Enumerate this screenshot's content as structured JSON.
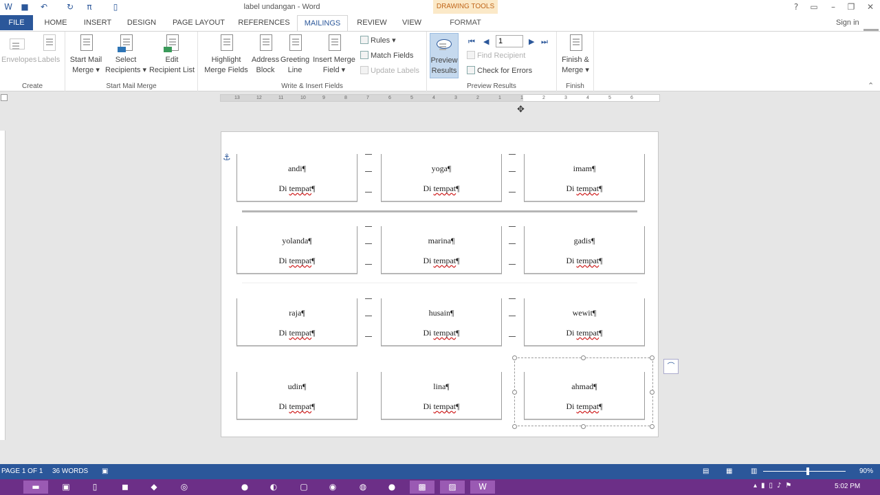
{
  "window": {
    "title": "label undangan - Word",
    "contextual_tab_header": "DRAWING TOOLS",
    "help": "?",
    "sign_in": "Sign in"
  },
  "quick_access": {
    "save_icon": "save-icon",
    "undo_icon": "undo-icon",
    "redo_icon": "redo-icon",
    "equation_icon": "equation-icon",
    "new_doc_icon": "new-document-icon"
  },
  "tabs": {
    "file": "FILE",
    "home": "HOME",
    "insert": "INSERT",
    "design": "DESIGN",
    "page_layout": "PAGE LAYOUT",
    "references": "REFERENCES",
    "mailings": "MAILINGS",
    "review": "REVIEW",
    "view": "VIEW",
    "format": "FORMAT",
    "active": "MAILINGS"
  },
  "ribbon": {
    "create": {
      "label": "Create",
      "envelopes": "Envelopes",
      "labels": "Labels"
    },
    "start_mail_merge": {
      "label": "Start Mail Merge",
      "start_line1": "Start Mail",
      "start_line2": "Merge ▾",
      "select_line1": "Select",
      "select_line2": "Recipients ▾",
      "edit_line1": "Edit",
      "edit_line2": "Recipient List"
    },
    "write_insert": {
      "label": "Write & Insert Fields",
      "highlight_line1": "Highlight",
      "highlight_line2": "Merge Fields",
      "address_line1": "Address",
      "address_line2": "Block",
      "greeting_line1": "Greeting",
      "greeting_line2": "Line",
      "insert_line1": "Insert Merge",
      "insert_line2": "Field ▾",
      "rules": "Rules ▾",
      "match_fields": "Match Fields",
      "update_labels": "Update Labels"
    },
    "preview": {
      "label": "Preview Results",
      "preview_line1": "Preview",
      "preview_line2": "Results",
      "record_value": "1",
      "find_recipient": "Find Recipient",
      "check_errors": "Check for Errors"
    },
    "finish": {
      "label": "Finish",
      "finish_line1": "Finish &",
      "finish_line2": "Merge ▾"
    }
  },
  "ruler": {
    "ticks": [
      "13",
      "12",
      "11",
      "10",
      "9",
      "8",
      "7",
      "6",
      "5",
      "4",
      "3",
      "2",
      "1",
      "1",
      "2",
      "3",
      "4",
      "5",
      "6"
    ]
  },
  "document": {
    "address_prefix": "Di ",
    "address_word": "tempat",
    "pilcrow": "¶",
    "labels": [
      [
        "andi",
        "yoga",
        "imam"
      ],
      [
        "yolanda",
        "marina",
        "gadis"
      ],
      [
        "raja",
        "husain",
        "wewit"
      ],
      [
        "udin",
        "lina",
        "ahmad"
      ]
    ]
  },
  "statusbar": {
    "page": "PAGE 1 OF 1",
    "words": "36 WORDS",
    "zoom": "90%"
  },
  "taskbar": {
    "time": "5:02 PM"
  },
  "colors": {
    "word_blue": "#2b579a",
    "taskbar_purple": "#6c2f87",
    "drawing_tools_bg": "#fbe9c8",
    "drawing_tools_text": "#c0661a",
    "spell_error": "#d02020"
  }
}
